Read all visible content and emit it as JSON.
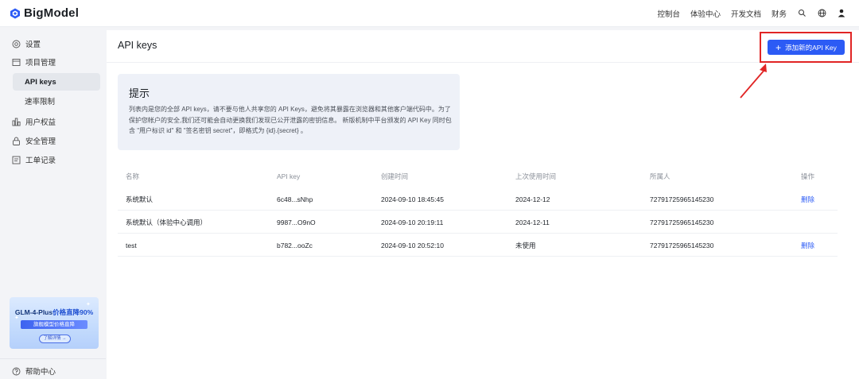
{
  "app": {
    "logo_text": "BigModel"
  },
  "topnav": {
    "items": [
      "控制台",
      "体验中心",
      "开发文档",
      "财务"
    ],
    "icons": [
      "search-people-icon",
      "globe-icon",
      "user-icon"
    ]
  },
  "sidebar": {
    "items": [
      {
        "label": "设置",
        "icon": "settings-icon"
      },
      {
        "label": "项目管理",
        "icon": "project-icon"
      },
      {
        "label": "API keys",
        "active": true
      },
      {
        "label": "速率限制"
      },
      {
        "label": "用户权益",
        "icon": "rights-icon"
      },
      {
        "label": "安全管理",
        "icon": "lock-icon"
      },
      {
        "label": "工单记录",
        "icon": "ticket-icon"
      }
    ],
    "promo": {
      "title_prefix": "GLM-4-Plus",
      "title_suffix": "价格直降90%",
      "band": "旗舰模型价格直降",
      "button": "了解详情 →"
    },
    "help": "帮助中心"
  },
  "main": {
    "title": "API keys",
    "add_button": "添加新的API Key",
    "tip": {
      "title": "提示",
      "body": "列表内是您的全部 API keys，请不要与他人共享您的 API Keys，避免将其暴露在浏览器和其他客户端代码中。为了保护您帐户的安全,我们还可能会自动更换我们发现已公开泄露的密钥信息。 新版机制中平台颁发的 API Key 同时包含 \"用户标识 id\" 和 \"签名密钥 secret\"，即格式为 {id}.{secret} 。"
    },
    "table": {
      "headers": [
        "名称",
        "API key",
        "创建时间",
        "上次使用时间",
        "所属人",
        "操作"
      ],
      "rows": [
        {
          "name": "系统默认",
          "key": "6c48...sNhp",
          "created": "2024-09-10 18:45:45",
          "last_used": "2024-12-12",
          "owner": "72791725965145230",
          "action": "删除"
        },
        {
          "name": "系统默认（体验中心调用）",
          "key": "9987...O9nO",
          "created": "2024-09-10 20:19:11",
          "last_used": "2024-12-11",
          "owner": "72791725965145230",
          "action": ""
        },
        {
          "name": "test",
          "key": "b782...ooZc",
          "created": "2024-09-10 20:52:10",
          "last_used": "未使用",
          "owner": "72791725965145230",
          "action": "删除"
        }
      ]
    }
  },
  "colors": {
    "accent": "#2c5bf5",
    "annotation": "#e12525"
  }
}
